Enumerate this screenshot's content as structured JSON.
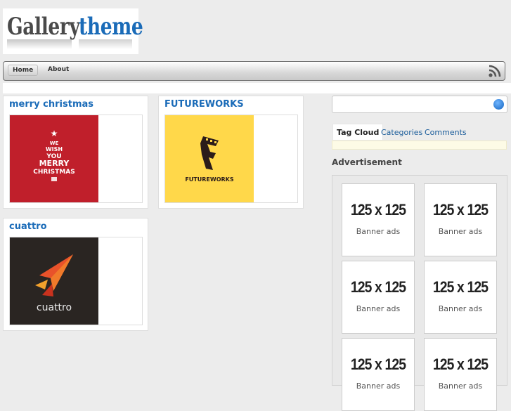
{
  "site": {
    "logo_word1": "Gallery",
    "logo_word2": "theme"
  },
  "nav": {
    "items": [
      {
        "label": "Home"
      },
      {
        "label": "About"
      }
    ]
  },
  "posts": [
    {
      "title": "merry christmas"
    },
    {
      "title": "FUTUREWORKS"
    },
    {
      "title": "cuattro"
    }
  ],
  "thumbs": {
    "christmas_lines": [
      "WE",
      "WISH",
      "YOU",
      "MERRY",
      "CHRISTMAS"
    ],
    "futureworks_text": "FUTUREWORKS",
    "cuattro_text": "cuattro"
  },
  "sidebar": {
    "search": {
      "placeholder": ""
    },
    "tabs": [
      {
        "label": "Tag Cloud"
      },
      {
        "label": "Categories"
      },
      {
        "label": "Comments"
      }
    ],
    "ad_heading": "Advertisement",
    "ads": [
      {
        "size": "125 x 125",
        "label": "Banner ads"
      },
      {
        "size": "125 x 125",
        "label": "Banner ads"
      },
      {
        "size": "125 x 125",
        "label": "Banner ads"
      },
      {
        "size": "125 x 125",
        "label": "Banner ads"
      },
      {
        "size": "125 x 125",
        "label": "Banner ads"
      },
      {
        "size": "125 x 125",
        "label": "Banner ads"
      }
    ]
  },
  "colors": {
    "link": "#1a6bb8",
    "christmas_bg": "#c01f2b",
    "futureworks_bg": "#ffd84a",
    "cuattro_bg": "#2a2522",
    "cuattro_accent": "#e8522a"
  }
}
